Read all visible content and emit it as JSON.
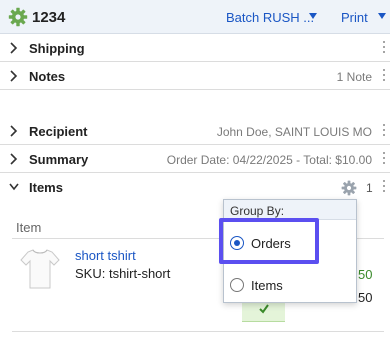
{
  "header": {
    "order_number": "1234",
    "batch_label": "Batch RUSH ...",
    "print_label": "Print",
    "icons": {
      "settings": "gear-icon",
      "dropdown": "caret-down-icon"
    },
    "colors": {
      "gear": "#6aa84f",
      "link": "#1a56c4"
    }
  },
  "sections": {
    "shipping": {
      "title": "Shipping"
    },
    "notes": {
      "title": "Notes",
      "summary": "1 Note"
    },
    "recipient": {
      "title": "Recipient",
      "summary": "John Doe, SAINT LOUIS MO"
    },
    "summary": {
      "title": "Summary",
      "summary": "Order Date: 04/22/2025 - Total: $10.00"
    },
    "items": {
      "title": "Items",
      "count": "1"
    }
  },
  "items_table": {
    "column_item": "Item",
    "rows": [
      {
        "name": "short tshirt",
        "sku": "SKU: tshirt-short",
        "value_a": "50",
        "value_b": "50"
      }
    ]
  },
  "group_by_popup": {
    "title": "Group By:",
    "options": [
      {
        "label": "Orders",
        "selected": true
      },
      {
        "label": "Items",
        "selected": false
      }
    ]
  }
}
